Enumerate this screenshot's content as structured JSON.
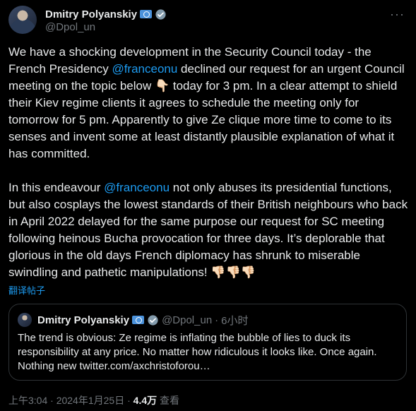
{
  "author": {
    "name": "Dmitry Polyanskiy",
    "handle": "@Dpol_un",
    "flag_icon": "un-flag-icon",
    "verified_icon": "verified-badge-icon"
  },
  "menu": {
    "more_label": "···"
  },
  "tweet": {
    "p1_a": "We have a shocking development in the Security Council today - the French Presidency ",
    "p1_mention": "@franceonu",
    "p1_b": " declined our request for an urgent Council meeting on the topic below 👇🏻 today for 3 pm. In a clear attempt to shield their Kiev regime clients it agrees to schedule the meeting only for tomorrow for 5 pm. Apparently to give Ze clique more time to come to its senses and invent some at least distantly plausible explanation of what it has committed.",
    "p2_a": "In this endeavour ",
    "p2_mention": "@franceonu",
    "p2_b": " not only abuses its presidential functions, but also cosplays the lowest standards of their British neighbours who back in April 2022 delayed for the same purpose our request for SC meeting following heinous Bucha provocation for three days. It’s deplorable that glorious in the old days French diplomacy has shrunk to miserable swindling and pathetic manipulations! 👎🏻👎🏻👎🏻"
  },
  "translate_label": "翻译帖子",
  "quote": {
    "name": "Dmitry Polyanskiy",
    "handle": "@Dpol_un",
    "separator": "·",
    "time": "6小时",
    "text": "The trend is obvious: Ze regime is inflating the bubble of lies to duck its responsibility at any price. No matter how ridiculous it looks like. Once again. Nothing new twitter.com/axchristoforou…"
  },
  "meta": {
    "time": "上午3:04",
    "separator": "·",
    "date": "2024年1月25日",
    "views_count": "4.4万",
    "views_label": "查看"
  },
  "colors": {
    "background": "#000000",
    "text": "#e7e9ea",
    "muted": "#71767b",
    "link": "#1d9bf0",
    "border": "#2f3336"
  }
}
